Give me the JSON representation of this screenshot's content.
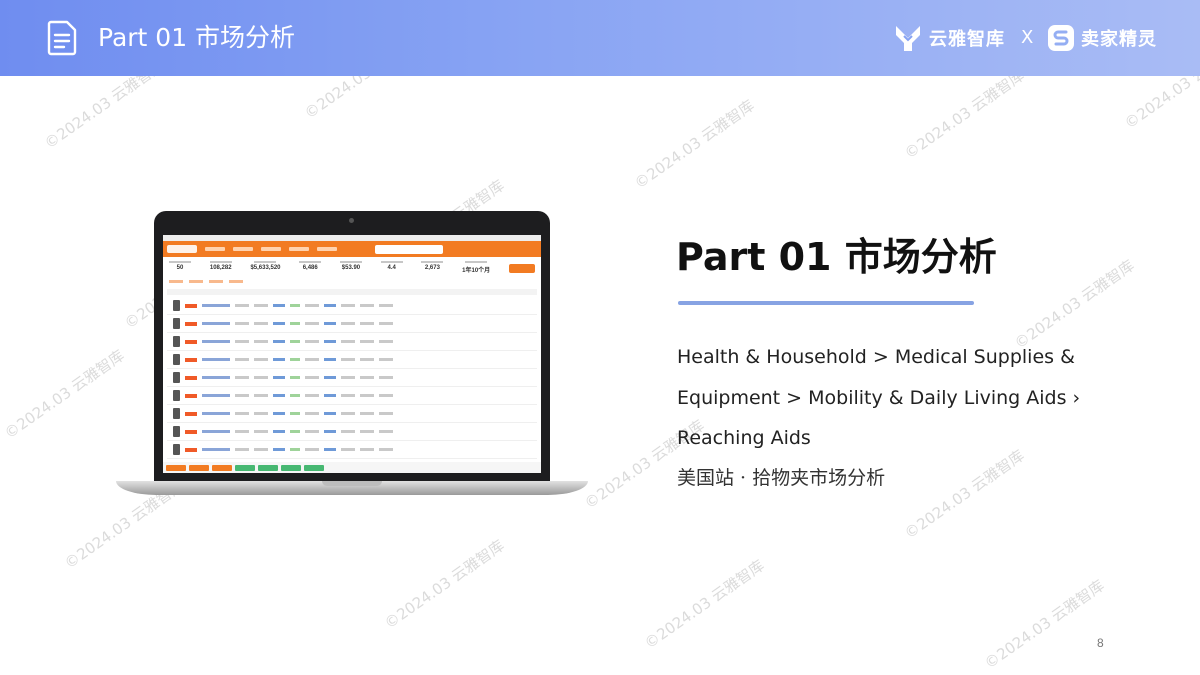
{
  "header": {
    "title": "Part 01 市场分析",
    "brand_left": "云雅智库",
    "separator": "X",
    "brand_right": "卖家精灵"
  },
  "watermark": "©2024.03 云雅智库",
  "laptop_app": {
    "stats": [
      "50",
      "108,282",
      "$5,633,520",
      "6,486",
      "$53.90",
      "4.4",
      "2,673",
      "1年10个月"
    ]
  },
  "content": {
    "title": "Part 01  市场分析",
    "category_path": "Health & Household >  Medical Supplies & Equipment > Mobility & Daily Living Aids › Reaching Aids",
    "subtitle": "美国站 · 拾物夹市场分析"
  },
  "page_number": "8",
  "colors": {
    "header_start": "#6f8df0",
    "header_end": "#a9bcf5",
    "divider": "#87a3e3",
    "app_accent": "#f27b22"
  }
}
